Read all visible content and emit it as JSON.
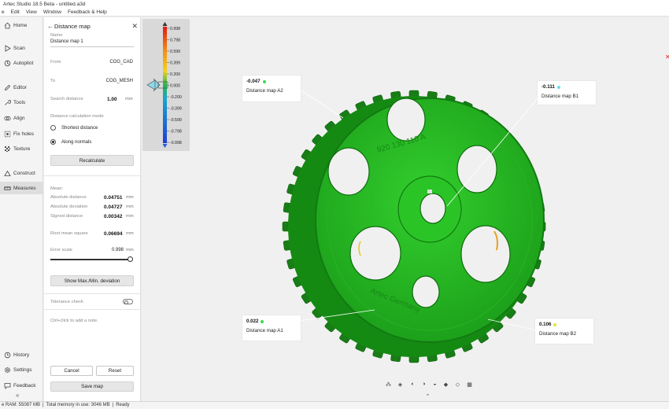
{
  "app": {
    "title": "Artec Studio 18.5 Beta - untitled.a3d",
    "menu": [
      "e",
      "Edit",
      "View",
      "Window",
      "Feedback & Help"
    ]
  },
  "nav": {
    "home": "Home",
    "scan": "Scan",
    "autopilot": "Autopilot",
    "editor": "Editor",
    "tools": "Tools",
    "align": "Align",
    "fixholes": "Fix holes",
    "texture": "Texture",
    "construct": "Construct",
    "measures": "Measures",
    "history": "History",
    "settings": "Settings",
    "feedback": "Feedback",
    "collapse": "«"
  },
  "panel": {
    "back": "←",
    "title": "Distance map",
    "close": "✕",
    "name_label": "Name",
    "name_value": "Distance map 1",
    "from_label": "From",
    "from_value": "COG_CAD",
    "to_label": "To",
    "to_value": "COG_MESH",
    "search_label": "Search distance",
    "search_value": "1.00",
    "search_unit": "mm",
    "mode_label": "Distance calculation mode",
    "mode_options": [
      "Shortest distance",
      "Along normals"
    ],
    "mode_selected": "Along normals",
    "recalc_button": "Recalculate",
    "mean_label": "Mean:",
    "stats": [
      {
        "label": "Absolute distance",
        "value": "0.04751",
        "unit": "mm"
      },
      {
        "label": "Absolute deviation",
        "value": "0.04727",
        "unit": "mm"
      },
      {
        "label": "Signed distance",
        "value": "0.00342",
        "unit": "mm"
      }
    ],
    "rms_label": "Root mean square",
    "rms_value": "0.06694",
    "rms_unit": "mm",
    "error_label": "Error scale",
    "error_value": "0.998",
    "error_unit": "mm",
    "error_fraction": 1.0,
    "maxmin_button": "Show Max./Min. deviation",
    "tolerance_label": "Tolerance check",
    "tolerance_on": false,
    "note_hint": "Ctrl+click to add a note.",
    "cancel_button": "Cancel",
    "reset_button": "Reset",
    "save_button": "Save map"
  },
  "scale": {
    "labels": [
      "0.998",
      "0.798",
      "0.599",
      "0.399",
      "0.200",
      "0.000",
      "-0.200",
      "-0.399",
      "-0.599",
      "-0.798",
      "-0.998"
    ],
    "colors": [
      "#e01a12",
      "#f58a12",
      "#f3d21a",
      "#28b84a",
      "#17a5cf",
      "#1f3fd6"
    ]
  },
  "callouts": [
    {
      "value": "-0.047",
      "name": "Distance map A2",
      "dot_color": "#3dd84a"
    },
    {
      "value": "-0.111",
      "name": "Distance map B1",
      "dot_color": "#66dff0"
    },
    {
      "value": "0.022",
      "name": "Distance map A1",
      "dot_color": "#3dd84a"
    },
    {
      "value": "0.106",
      "name": "Distance map B2",
      "dot_color": "#e8e23a"
    }
  ],
  "model": {
    "engraving_top": "920 130 110 A",
    "engraving_bottom": "Artec  Germany",
    "color": "#1fbd1f"
  },
  "viewport": {
    "bottom_chevron": "⌃",
    "close_mark": "✕"
  },
  "status": {
    "ram": "e RAM: 55087 MB",
    "memory": "Total memory in use: 3046 MB",
    "state": "Ready"
  }
}
